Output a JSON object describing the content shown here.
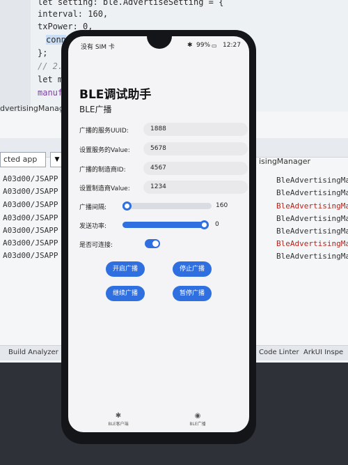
{
  "editor": {
    "lines": [
      "let setting: ble.AdvertiseSetting = {",
      "  interval: 160,",
      "  txPower: 0,",
      "  conn",
      "};",
      "// 2.",
      "let m",
      "manuf"
    ]
  },
  "log_panel": {
    "left_tab": "dvertisingManager",
    "app_select": "cted app",
    "right_tab": "isingManager",
    "left_rows": [
      "A03d00/JSAPP",
      "A03d00/JSAPP",
      "A03d00/JSAPP",
      "A03d00/JSAPP",
      "A03d00/JSAPP",
      "A03d00/JSAPP",
      "A03d00/JSAPP"
    ],
    "right_rows": [
      "BleAdvertisingMa",
      "BleAdvertisingMa",
      "BleAdvertisingMa",
      "BleAdvertisingMa",
      "BleAdvertisingMa",
      "BleAdvertisingMa",
      "BleAdvertisingMa"
    ]
  },
  "bottom_bar": {
    "build_analyzer": "Build Analyzer",
    "code_linter": "Code Linter",
    "arkui_inspector": "ArkUI Inspe"
  },
  "status_bar": {
    "carrier": "没有 SIM 卡",
    "battery": "99%",
    "time": "12:27"
  },
  "app": {
    "title": "BLE调试助手",
    "subtitle": "BLE广播",
    "fields": [
      {
        "label": "广播的服务UUID:",
        "value": "1888"
      },
      {
        "label": "设置服务的Value:",
        "value": "5678"
      },
      {
        "label": "广播的制造商ID:",
        "value": "4567"
      },
      {
        "label": "设置制造商Value:",
        "value": "1234"
      }
    ],
    "interval": {
      "label": "广播间隔:",
      "value": "160",
      "fraction": 0.0
    },
    "tx_power": {
      "label": "发送功率:",
      "value": "0",
      "fraction": 1.0
    },
    "connectable": {
      "label": "是否可连接:",
      "on": true
    },
    "buttons": {
      "start": "开启广播",
      "stop": "停止广播",
      "resume": "继续广播",
      "pause": "暂停广播"
    },
    "tabs": [
      {
        "icon": "bluetooth-icon",
        "label": "BLE客户端"
      },
      {
        "icon": "broadcast-icon",
        "label": "BLE广播"
      }
    ]
  },
  "colors": {
    "accent": "#2f6fe0",
    "error_log": "#b3261e"
  }
}
